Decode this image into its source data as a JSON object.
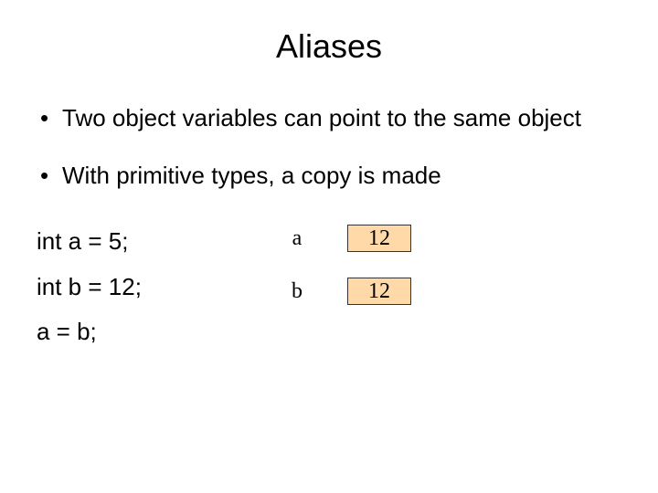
{
  "title": "Aliases",
  "bullets": [
    "Two object variables can point to the same object",
    "With primitive types, a copy is made"
  ],
  "code": {
    "line1": "int a = 5;",
    "line2": "int b = 12;",
    "line3": "a = b;"
  },
  "vars": {
    "a_label": "a",
    "a_value": "12",
    "b_label": "b",
    "b_value": "12"
  }
}
